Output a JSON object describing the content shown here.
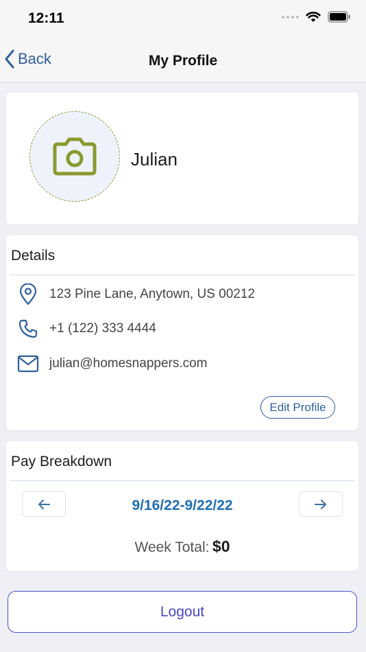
{
  "status_bar": {
    "time": "12:11"
  },
  "nav": {
    "back_label": "Back",
    "title": "My Profile"
  },
  "profile": {
    "name": "Julian"
  },
  "details": {
    "title": "Details",
    "address": "123 Pine Lane, Anytown, US 00212",
    "phone": "+1 (122) 333 4444",
    "email": "julian@homesnappers.com",
    "edit_label": "Edit Profile"
  },
  "pay": {
    "title": "Pay Breakdown",
    "date_range": "9/16/22-9/22/22",
    "week_total_label": "Week Total:",
    "week_total_amount": "$0"
  },
  "logout_label": "Logout",
  "colors": {
    "accent_blue": "#2f5f9a",
    "date_blue": "#1f6fb5",
    "olive": "#8a9a2e",
    "logout_purple": "#4848c8"
  }
}
